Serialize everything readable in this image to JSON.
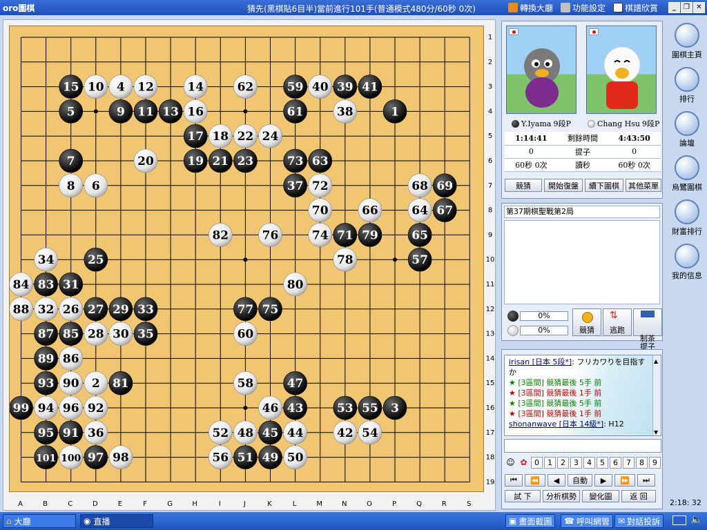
{
  "window": {
    "app_name": "oro圍棋",
    "title": "猜先(黑棋貼6目半)當前進行101手(普通模式480分/60秒 0次)",
    "toolbar": [
      {
        "label": "轉換大廳",
        "icon": "lobby-icon"
      },
      {
        "label": "功能設定",
        "icon": "tools-icon"
      },
      {
        "label": "棋譜欣賞",
        "icon": "kifu-icon"
      }
    ],
    "controls": {
      "minimize": "_",
      "restore": "❐",
      "close": "✕"
    }
  },
  "board": {
    "size": 19,
    "col_labels": [
      "A",
      "B",
      "C",
      "D",
      "E",
      "F",
      "G",
      "H",
      "I",
      "J",
      "K",
      "L",
      "M",
      "N",
      "O",
      "P",
      "Q",
      "R",
      "S"
    ],
    "row_labels": [
      "1",
      "2",
      "3",
      "4",
      "5",
      "6",
      "7",
      "8",
      "9",
      "10",
      "11",
      "12",
      "13",
      "14",
      "15",
      "16",
      "17",
      "18",
      "19"
    ],
    "last_move": 101,
    "stones": [
      {
        "n": 1,
        "c": "b",
        "col": 16,
        "row": 4
      },
      {
        "n": 2,
        "c": "w",
        "col": 4,
        "row": 15
      },
      {
        "n": 3,
        "c": "b",
        "col": 16,
        "row": 16
      },
      {
        "n": 4,
        "c": "w",
        "col": 5,
        "row": 3
      },
      {
        "n": 5,
        "c": "b",
        "col": 3,
        "row": 4
      },
      {
        "n": 6,
        "c": "w",
        "col": 4,
        "row": 7
      },
      {
        "n": 7,
        "c": "b",
        "col": 3,
        "row": 6
      },
      {
        "n": 8,
        "c": "w",
        "col": 3,
        "row": 7
      },
      {
        "n": 9,
        "c": "b",
        "col": 5,
        "row": 4
      },
      {
        "n": 10,
        "c": "w",
        "col": 4,
        "row": 3
      },
      {
        "n": 11,
        "c": "b",
        "col": 6,
        "row": 4
      },
      {
        "n": 12,
        "c": "w",
        "col": 6,
        "row": 3
      },
      {
        "n": 13,
        "c": "b",
        "col": 7,
        "row": 4
      },
      {
        "n": 14,
        "c": "w",
        "col": 8,
        "row": 3
      },
      {
        "n": 15,
        "c": "b",
        "col": 3,
        "row": 3
      },
      {
        "n": 16,
        "c": "w",
        "col": 8,
        "row": 4
      },
      {
        "n": 17,
        "c": "b",
        "col": 8,
        "row": 5
      },
      {
        "n": 18,
        "c": "w",
        "col": 9,
        "row": 5
      },
      {
        "n": 19,
        "c": "b",
        "col": 8,
        "row": 6
      },
      {
        "n": 20,
        "c": "w",
        "col": 6,
        "row": 6
      },
      {
        "n": 21,
        "c": "b",
        "col": 9,
        "row": 6
      },
      {
        "n": 22,
        "c": "w",
        "col": 10,
        "row": 5
      },
      {
        "n": 23,
        "c": "b",
        "col": 10,
        "row": 6
      },
      {
        "n": 24,
        "c": "w",
        "col": 11,
        "row": 5
      },
      {
        "n": 25,
        "c": "b",
        "col": 4,
        "row": 10
      },
      {
        "n": 26,
        "c": "w",
        "col": 3,
        "row": 12
      },
      {
        "n": 27,
        "c": "b",
        "col": 4,
        "row": 12
      },
      {
        "n": 28,
        "c": "w",
        "col": 4,
        "row": 13
      },
      {
        "n": 29,
        "c": "b",
        "col": 5,
        "row": 12
      },
      {
        "n": 30,
        "c": "w",
        "col": 5,
        "row": 13
      },
      {
        "n": 31,
        "c": "b",
        "col": 3,
        "row": 11
      },
      {
        "n": 32,
        "c": "w",
        "col": 2,
        "row": 12
      },
      {
        "n": 33,
        "c": "b",
        "col": 6,
        "row": 12
      },
      {
        "n": 34,
        "c": "w",
        "col": 2,
        "row": 10
      },
      {
        "n": 35,
        "c": "b",
        "col": 6,
        "row": 13
      },
      {
        "n": 36,
        "c": "w",
        "col": 4,
        "row": 17
      },
      {
        "n": 37,
        "c": "b",
        "col": 12,
        "row": 7
      },
      {
        "n": 38,
        "c": "w",
        "col": 14,
        "row": 4
      },
      {
        "n": 39,
        "c": "b",
        "col": 14,
        "row": 3
      },
      {
        "n": 40,
        "c": "w",
        "col": 13,
        "row": 3
      },
      {
        "n": 41,
        "c": "b",
        "col": 15,
        "row": 3
      },
      {
        "n": 42,
        "c": "w",
        "col": 14,
        "row": 17
      },
      {
        "n": 43,
        "c": "b",
        "col": 12,
        "row": 16
      },
      {
        "n": 44,
        "c": "w",
        "col": 12,
        "row": 17
      },
      {
        "n": 45,
        "c": "b",
        "col": 11,
        "row": 17
      },
      {
        "n": 46,
        "c": "w",
        "col": 11,
        "row": 16
      },
      {
        "n": 47,
        "c": "b",
        "col": 12,
        "row": 15
      },
      {
        "n": 48,
        "c": "w",
        "col": 10,
        "row": 17
      },
      {
        "n": 49,
        "c": "b",
        "col": 11,
        "row": 18
      },
      {
        "n": 50,
        "c": "w",
        "col": 12,
        "row": 18
      },
      {
        "n": 51,
        "c": "b",
        "col": 10,
        "row": 18
      },
      {
        "n": 52,
        "c": "w",
        "col": 9,
        "row": 17
      },
      {
        "n": 53,
        "c": "b",
        "col": 14,
        "row": 16
      },
      {
        "n": 54,
        "c": "w",
        "col": 15,
        "row": 17
      },
      {
        "n": 55,
        "c": "b",
        "col": 15,
        "row": 16
      },
      {
        "n": 56,
        "c": "w",
        "col": 9,
        "row": 18
      },
      {
        "n": 57,
        "c": "b",
        "col": 17,
        "row": 10
      },
      {
        "n": 58,
        "c": "w",
        "col": 10,
        "row": 15
      },
      {
        "n": 59,
        "c": "b",
        "col": 12,
        "row": 3
      },
      {
        "n": 60,
        "c": "w",
        "col": 10,
        "row": 13
      },
      {
        "n": 61,
        "c": "b",
        "col": 12,
        "row": 4
      },
      {
        "n": 62,
        "c": "w",
        "col": 10,
        "row": 3
      },
      {
        "n": 63,
        "c": "b",
        "col": 13,
        "row": 6
      },
      {
        "n": 64,
        "c": "w",
        "col": 17,
        "row": 8
      },
      {
        "n": 65,
        "c": "b",
        "col": 17,
        "row": 9
      },
      {
        "n": 66,
        "c": "w",
        "col": 15,
        "row": 8
      },
      {
        "n": 67,
        "c": "b",
        "col": 18,
        "row": 8
      },
      {
        "n": 68,
        "c": "w",
        "col": 17,
        "row": 7
      },
      {
        "n": 69,
        "c": "b",
        "col": 18,
        "row": 7
      },
      {
        "n": 70,
        "c": "w",
        "col": 13,
        "row": 8
      },
      {
        "n": 71,
        "c": "b",
        "col": 14,
        "row": 9
      },
      {
        "n": 72,
        "c": "w",
        "col": 13,
        "row": 7
      },
      {
        "n": 73,
        "c": "b",
        "col": 12,
        "row": 6
      },
      {
        "n": 74,
        "c": "w",
        "col": 13,
        "row": 9
      },
      {
        "n": 75,
        "c": "b",
        "col": 11,
        "row": 12
      },
      {
        "n": 76,
        "c": "w",
        "col": 11,
        "row": 9
      },
      {
        "n": 77,
        "c": "b",
        "col": 10,
        "row": 12
      },
      {
        "n": 78,
        "c": "w",
        "col": 14,
        "row": 10
      },
      {
        "n": 79,
        "c": "b",
        "col": 15,
        "row": 9
      },
      {
        "n": 80,
        "c": "w",
        "col": 12,
        "row": 11
      },
      {
        "n": 81,
        "c": "b",
        "col": 5,
        "row": 15
      },
      {
        "n": 82,
        "c": "w",
        "col": 9,
        "row": 9
      },
      {
        "n": 83,
        "c": "b",
        "col": 2,
        "row": 11
      },
      {
        "n": 84,
        "c": "w",
        "col": 1,
        "row": 11
      },
      {
        "n": 85,
        "c": "b",
        "col": 3,
        "row": 13
      },
      {
        "n": 86,
        "c": "w",
        "col": 3,
        "row": 14
      },
      {
        "n": 87,
        "c": "b",
        "col": 2,
        "row": 13
      },
      {
        "n": 88,
        "c": "w",
        "col": 1,
        "row": 12
      },
      {
        "n": 89,
        "c": "b",
        "col": 2,
        "row": 14
      },
      {
        "n": 90,
        "c": "w",
        "col": 3,
        "row": 15
      },
      {
        "n": 91,
        "c": "b",
        "col": 3,
        "row": 17
      },
      {
        "n": 92,
        "c": "w",
        "col": 4,
        "row": 16
      },
      {
        "n": 93,
        "c": "b",
        "col": 2,
        "row": 15
      },
      {
        "n": 94,
        "c": "w",
        "col": 2,
        "row": 16
      },
      {
        "n": 95,
        "c": "b",
        "col": 2,
        "row": 17
      },
      {
        "n": 96,
        "c": "w",
        "col": 3,
        "row": 16
      },
      {
        "n": 97,
        "c": "b",
        "col": 4,
        "row": 18
      },
      {
        "n": 98,
        "c": "w",
        "col": 5,
        "row": 18
      },
      {
        "n": 99,
        "c": "b",
        "col": 1,
        "row": 16
      },
      {
        "n": 100,
        "c": "w",
        "col": 3,
        "row": 18
      },
      {
        "n": 101,
        "c": "b",
        "col": 2,
        "row": 18
      }
    ]
  },
  "players": {
    "black": {
      "name": "Y.Iyama",
      "rank": "9段P",
      "time_used": "1:14:41",
      "captures": "0",
      "byoyomi": "60秒 0次"
    },
    "white": {
      "name": "Chang Hsu",
      "rank": "9段P",
      "time_left": "4:43:50",
      "captures": "0",
      "byoyomi": "60秒 0次"
    },
    "labels": {
      "remaining": "剩餘時間",
      "captures": "提子",
      "byoyomi": "讀秒"
    }
  },
  "actions": [
    "競猜",
    "開始復盤",
    "續下圍棋",
    "其他菜單"
  ],
  "game_info": {
    "title": "第37期棋聖戰第2局"
  },
  "predict": {
    "black_pct": "0%",
    "white_pct": "0%",
    "buttons": [
      {
        "label": "競猜",
        "icon": "coin-icon"
      },
      {
        "label": "逃跑",
        "icon": "arrows-icon"
      },
      {
        "label": "制茶\n提子",
        "icon": "capture-icon"
      }
    ]
  },
  "chat": {
    "lines": [
      {
        "user": "irisan [日本 5段*]",
        "text": ": フリカワりを目指すか",
        "star": "",
        "color": "#000080"
      },
      {
        "user": "",
        "text": "★ [3區間] 競猜最後 5手 前",
        "star": "green",
        "color": "#008000"
      },
      {
        "user": "",
        "text": "★ [3區間] 競猜最後 1手 前",
        "star": "red",
        "color": "#c00000"
      },
      {
        "user": "",
        "text": "★ [3區間] 競猜最後 5手 前",
        "star": "green",
        "color": "#008000"
      },
      {
        "user": "",
        "text": "★ [3區間] 競猜最後 1手 前",
        "star": "red",
        "color": "#c00000"
      },
      {
        "user": "shonanwave [日本 14級*]",
        "text": ": H12",
        "star": "",
        "color": "#000080"
      }
    ],
    "numbers": [
      "0",
      "1",
      "2",
      "3",
      "4",
      "5",
      "6",
      "7",
      "8",
      "9"
    ]
  },
  "nav": {
    "first": "⏮",
    "prev10": "⏪",
    "prev": "◀",
    "auto": "自動",
    "next": "▶",
    "next10": "⏩",
    "last": "⏭",
    "tools": [
      "試 下",
      "分析棋勢",
      "變化圖",
      "返 回"
    ]
  },
  "clock": "2:18: 32",
  "sidebar": [
    {
      "label": "圍棋主頁",
      "icon": "home-icon"
    },
    {
      "label": "排行",
      "icon": "ranking-icon"
    },
    {
      "label": "論壇",
      "icon": "forum-icon"
    },
    {
      "label": "烏鷺圍棋",
      "icon": "go-bowl-icon"
    },
    {
      "label": "財富排行",
      "icon": "wealth-icon"
    },
    {
      "label": "我的信息",
      "icon": "message-icon"
    }
  ],
  "taskbar": {
    "tasks": [
      {
        "label": "大廳",
        "icon": "house-icon"
      },
      {
        "label": "直播",
        "icon": "broadcast-icon"
      }
    ],
    "tray": [
      {
        "label": "畫面截圖",
        "icon": "camera-icon"
      },
      {
        "label": "呼叫網管",
        "icon": "call-icon"
      },
      {
        "label": "對話投訴",
        "icon": "report-icon"
      }
    ]
  },
  "colors": {
    "board": "#f0c672",
    "panel": "#c8d8f0",
    "titlebar": "#1e4fb8"
  }
}
